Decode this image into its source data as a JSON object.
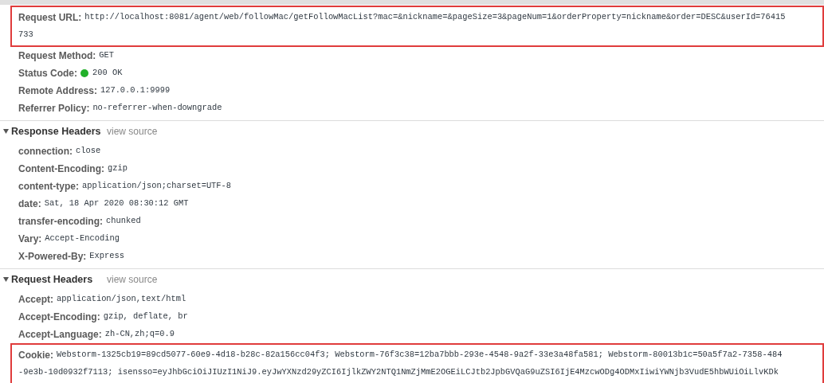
{
  "sections": [
    {
      "expanded": true,
      "rows": [
        {
          "name": "Request URL:",
          "kind": "plain",
          "highlighted": true,
          "lines": [
            "http://localhost:8081/agent/web/followMac/getFollowMacList?mac=&nickname=&pageSize=3&pageNum=1&orderProperty=nickname&order=DESC&userId=76415",
            "733"
          ]
        },
        {
          "name": "Request Method:",
          "kind": "plain",
          "highlighted": false,
          "lines": [
            "GET"
          ]
        },
        {
          "name": "Status Code:",
          "kind": "status",
          "highlighted": false,
          "lines": [
            "200 OK"
          ]
        },
        {
          "name": "Remote Address:",
          "kind": "plain",
          "highlighted": false,
          "lines": [
            "127.0.0.1:9999"
          ]
        },
        {
          "name": "Referrer Policy:",
          "kind": "plain",
          "highlighted": false,
          "lines": [
            "no-referrer-when-downgrade"
          ]
        }
      ]
    },
    {
      "title": "Response Headers",
      "link": "view source",
      "expanded": true,
      "rows": [
        {
          "name": "connection:",
          "kind": "plain",
          "highlighted": false,
          "lines": [
            "close"
          ]
        },
        {
          "name": "Content-Encoding:",
          "kind": "plain",
          "highlighted": false,
          "lines": [
            "gzip"
          ]
        },
        {
          "name": "content-type:",
          "kind": "plain",
          "highlighted": false,
          "lines": [
            "application/json;charset=UTF-8"
          ]
        },
        {
          "name": "date:",
          "kind": "plain",
          "highlighted": false,
          "lines": [
            "Sat, 18 Apr 2020 08:30:12 GMT"
          ]
        },
        {
          "name": "transfer-encoding:",
          "kind": "plain",
          "highlighted": false,
          "lines": [
            "chunked"
          ]
        },
        {
          "name": "Vary:",
          "kind": "plain",
          "highlighted": false,
          "lines": [
            "Accept-Encoding"
          ]
        },
        {
          "name": "X-Powered-By:",
          "kind": "plain",
          "highlighted": false,
          "lines": [
            "Express"
          ]
        }
      ]
    },
    {
      "title": "Request Headers",
      "link": "view source",
      "expanded": true,
      "rows": [
        {
          "name": "Accept:",
          "kind": "plain",
          "highlighted": false,
          "lines": [
            "application/json,text/html"
          ]
        },
        {
          "name": "Accept-Encoding:",
          "kind": "plain",
          "highlighted": false,
          "lines": [
            "gzip, deflate, br"
          ]
        },
        {
          "name": "Accept-Language:",
          "kind": "plain",
          "highlighted": false,
          "lines": [
            "zh-CN,zh;q=0.9"
          ]
        },
        {
          "name": "Cookie:",
          "kind": "plain",
          "highlighted": true,
          "lines": [
            "Webstorm-1325cb19=89cd5077-60e9-4d18-b28c-82a156cc04f3; Webstorm-76f3c38=12ba7bbb-293e-4548-9a2f-33e3a48fa581; Webstorm-80013b1c=50a5f7a2-7358-484",
            "-9e3b-10d0932f7113; isensso=eyJhbGciOiJIUzI1NiJ9.eyJwYXNzd29yZCI6IjlkZWY2NTQ1NmZjMmE2OGEiLCJtb2JpbGVQaG9uZSI6IjE4MzcwODg4ODMxIiwiYWNjb3VudE5hbWUiOiLlvKDk"
          ]
        }
      ]
    }
  ]
}
